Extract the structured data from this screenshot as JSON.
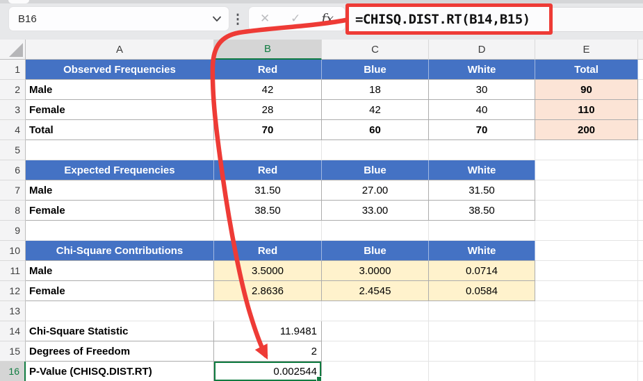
{
  "app": {
    "type": "spreadsheet"
  },
  "formula_bar": {
    "name_box_value": "B16",
    "formula": "=CHISQ.DIST.RT(B14,B15)",
    "cancel_glyph": "✕",
    "enter_glyph": "✓",
    "fx_glyph": "fx"
  },
  "colors": {
    "header_blue": "#4472C4",
    "fill_peach": "#FCE4D6",
    "fill_yellow": "#FFF2CC",
    "selection_green": "#107C41",
    "annotation_red": "#EE3B36"
  },
  "sheet": {
    "columns": [
      "A",
      "B",
      "C",
      "D",
      "E"
    ],
    "selected_cell": "B16",
    "selected_column": "B",
    "selected_row": 16,
    "rows": [
      [
        {
          "t": "Observed Frequencies",
          "f": "blue"
        },
        {
          "t": "Red",
          "f": "blue"
        },
        {
          "t": "Blue",
          "f": "blue"
        },
        {
          "t": "White",
          "f": "blue"
        },
        {
          "t": "Total",
          "f": "blue"
        }
      ],
      [
        {
          "t": "Male",
          "b": 1,
          "a": "l",
          "bd": 1
        },
        {
          "t": "42",
          "bd": 1
        },
        {
          "t": "18",
          "bd": 1
        },
        {
          "t": "30",
          "bd": 1
        },
        {
          "t": "90",
          "b": 1,
          "f": "peach",
          "bd": 1
        }
      ],
      [
        {
          "t": "Female",
          "b": 1,
          "a": "l",
          "bd": 1
        },
        {
          "t": "28",
          "bd": 1
        },
        {
          "t": "42",
          "bd": 1
        },
        {
          "t": "40",
          "bd": 1
        },
        {
          "t": "110",
          "b": 1,
          "f": "peach",
          "bd": 1
        }
      ],
      [
        {
          "t": "Total",
          "b": 1,
          "a": "l",
          "bd": 1
        },
        {
          "t": "70",
          "b": 1,
          "bd": 1
        },
        {
          "t": "60",
          "b": 1,
          "bd": 1
        },
        {
          "t": "70",
          "b": 1,
          "bd": 1
        },
        {
          "t": "200",
          "b": 1,
          "f": "peach",
          "bd": 1
        }
      ],
      [
        null,
        null,
        null,
        null,
        null
      ],
      [
        {
          "t": "Expected Frequencies",
          "f": "blue"
        },
        {
          "t": "Red",
          "f": "blue"
        },
        {
          "t": "Blue",
          "f": "blue"
        },
        {
          "t": "White",
          "f": "blue"
        },
        null
      ],
      [
        {
          "t": "Male",
          "b": 1,
          "a": "l",
          "bd": 1
        },
        {
          "t": "31.50",
          "bd": 1
        },
        {
          "t": "27.00",
          "bd": 1
        },
        {
          "t": "31.50",
          "bd": 1
        },
        null
      ],
      [
        {
          "t": "Female",
          "b": 1,
          "a": "l",
          "bd": 1
        },
        {
          "t": "38.50",
          "bd": 1
        },
        {
          "t": "33.00",
          "bd": 1
        },
        {
          "t": "38.50",
          "bd": 1
        },
        null
      ],
      [
        null,
        null,
        null,
        null,
        null
      ],
      [
        {
          "t": "Chi-Square Contributions",
          "f": "blue"
        },
        {
          "t": "Red",
          "f": "blue"
        },
        {
          "t": "Blue",
          "f": "blue"
        },
        {
          "t": "White",
          "f": "blue"
        },
        null
      ],
      [
        {
          "t": "Male",
          "b": 1,
          "a": "l",
          "bd": 1
        },
        {
          "t": "3.5000",
          "f": "yellow",
          "bd": 1
        },
        {
          "t": "3.0000",
          "f": "yellow",
          "bd": 1
        },
        {
          "t": "0.0714",
          "f": "yellow",
          "bd": 1
        },
        null
      ],
      [
        {
          "t": "Female",
          "b": 1,
          "a": "l",
          "bd": 1
        },
        {
          "t": "2.8636",
          "f": "yellow",
          "bd": 1
        },
        {
          "t": "2.4545",
          "f": "yellow",
          "bd": 1
        },
        {
          "t": "0.0584",
          "f": "yellow",
          "bd": 1
        },
        null
      ],
      [
        null,
        null,
        null,
        null,
        null
      ],
      [
        {
          "t": "Chi-Square Statistic",
          "b": 1,
          "a": "l",
          "bd": 1
        },
        {
          "t": "11.9481",
          "a": "r",
          "bd": 1
        },
        null,
        null,
        null
      ],
      [
        {
          "t": "Degrees of Freedom",
          "b": 1,
          "a": "l",
          "bd": 1
        },
        {
          "t": "2",
          "a": "r",
          "bd": 1
        },
        null,
        null,
        null
      ],
      [
        {
          "t": "P-Value (CHISQ.DIST.RT)",
          "b": 1,
          "a": "l",
          "bd": 1
        },
        {
          "t": "0.002544",
          "a": "r",
          "bd": 1,
          "sel": 1
        },
        null,
        null,
        null
      ]
    ]
  }
}
